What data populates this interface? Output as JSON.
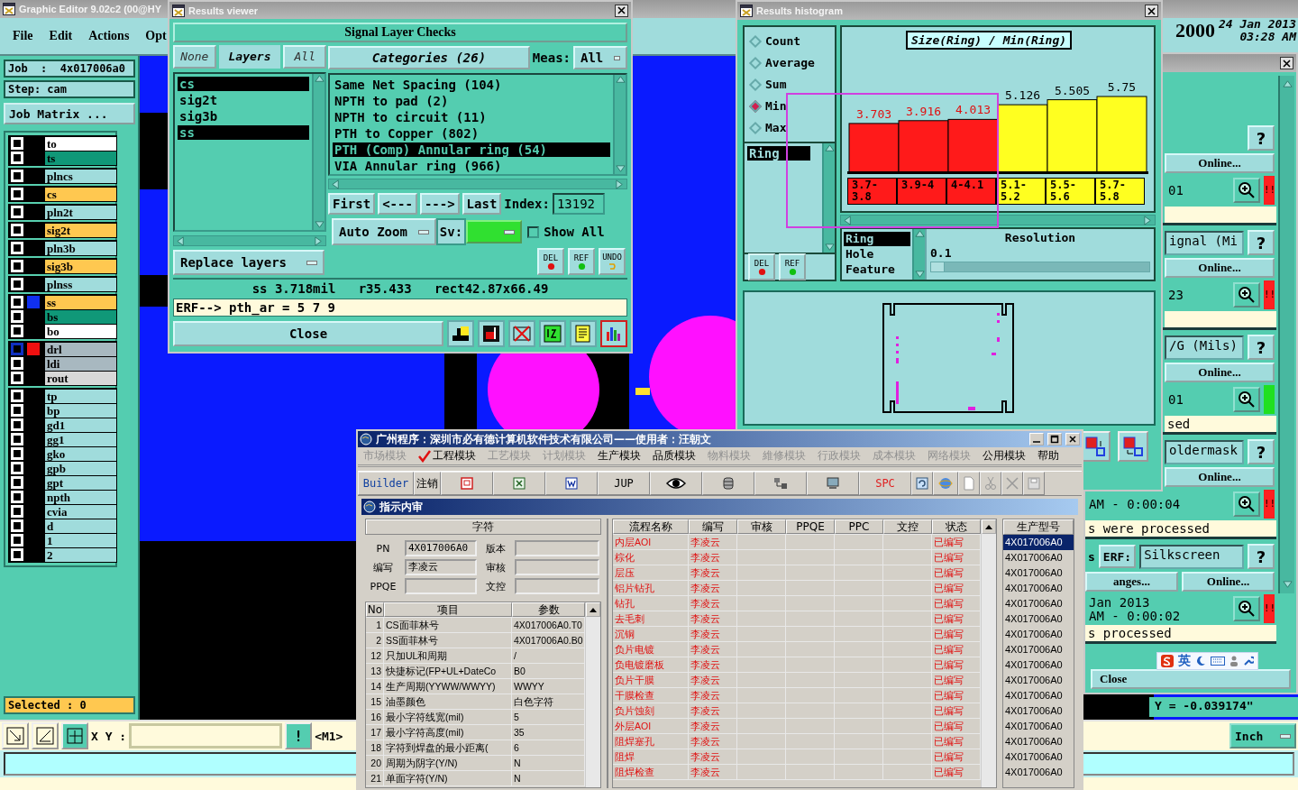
{
  "editor": {
    "title": "Graphic Editor 9.02c2 (00@HY",
    "menu": [
      "File",
      "Edit",
      "Actions",
      "Opt"
    ],
    "clock": {
      "year": "2000",
      "date": "24 Jan 2013",
      "time": "03:28 AM"
    },
    "job": "Job  :  4x017006a0",
    "step": "Step: cam",
    "job_matrix": "Job Matrix ...",
    "layer_groups": [
      [
        {
          "name": "to",
          "color": "#ffffff",
          "checked": false,
          "active": false
        },
        {
          "name": "ts",
          "color": "#109878",
          "checked": false,
          "active": false
        }
      ],
      [
        {
          "name": "plncs",
          "color": "#a0dcdc",
          "checked": false,
          "active": false
        }
      ],
      [
        {
          "name": "cs",
          "color": "#ffc850",
          "checked": false,
          "active": false
        }
      ],
      [
        {
          "name": "pln2t",
          "color": "#a0dcdc",
          "checked": false,
          "active": false
        }
      ],
      [
        {
          "name": "sig2t",
          "color": "#ffc850",
          "checked": false,
          "active": false
        }
      ],
      [
        {
          "name": "pln3b",
          "color": "#a0dcdc",
          "checked": false,
          "active": false
        }
      ],
      [
        {
          "name": "sig3b",
          "color": "#ffc850",
          "checked": false,
          "active": false
        }
      ],
      [
        {
          "name": "plnss",
          "color": "#a0dcdc",
          "checked": false,
          "active": false
        }
      ],
      [
        {
          "name": "ss",
          "color": "#ffc850",
          "swatch": {
            "color": "#1030f0"
          },
          "checked": false,
          "active": false
        },
        {
          "name": "bs",
          "color": "#109878",
          "checked": false,
          "active": false
        },
        {
          "name": "bo",
          "color": "#ffffff",
          "checked": false,
          "active": false
        }
      ],
      [
        {
          "name": "drl",
          "color": "#a8b8c0",
          "swatch": {
            "color": "#f01010"
          },
          "checked": false,
          "active": true
        },
        {
          "name": "ldi",
          "color": "#a8b8c0",
          "checked": false,
          "active": false
        },
        {
          "name": "rout",
          "color": "#d8d8d8",
          "checked": false,
          "active": false
        }
      ],
      [
        {
          "name": "tp",
          "color": "#a0dcdc",
          "checked": false,
          "active": false
        },
        {
          "name": "bp",
          "color": "#a0dcdc",
          "checked": false,
          "active": false
        },
        {
          "name": "gd1",
          "color": "#a0dcdc",
          "checked": false,
          "active": false
        },
        {
          "name": "gg1",
          "color": "#a0dcdc",
          "checked": false,
          "active": false
        },
        {
          "name": "gko",
          "color": "#a0dcdc",
          "checked": false,
          "active": false
        },
        {
          "name": "gpb",
          "color": "#a0dcdc",
          "checked": false,
          "active": false
        },
        {
          "name": "gpt",
          "color": "#a0dcdc",
          "checked": false,
          "active": false
        },
        {
          "name": "npth",
          "color": "#a0dcdc",
          "checked": false,
          "active": false
        },
        {
          "name": "cvia",
          "color": "#a0dcdc",
          "checked": false,
          "active": false
        },
        {
          "name": "d",
          "color": "#a0dcdc",
          "checked": false,
          "active": false
        },
        {
          "name": "1",
          "color": "#a0dcdc",
          "checked": false,
          "active": false
        },
        {
          "name": "2",
          "color": "#a0dcdc",
          "checked": false,
          "active": false
        }
      ]
    ],
    "selected": "Selected : 0",
    "xy_label": "X Y :",
    "alert": "!",
    "mode": "<M1>",
    "y_reading": "Y = -0.039174\"",
    "units": "Inch"
  },
  "results_viewer": {
    "title": "Results viewer",
    "heading": "Signal Layer Checks",
    "layer_tabs": [
      {
        "label": "None",
        "selected": false
      },
      {
        "label": "Layers",
        "selected": true
      },
      {
        "label": "All",
        "selected": false
      }
    ],
    "layers": [
      {
        "name": "cs",
        "selected": true
      },
      {
        "name": "sig2t",
        "selected": false
      },
      {
        "name": "sig3b",
        "selected": false
      },
      {
        "name": "ss",
        "selected": true
      }
    ],
    "categories_label": "Categories (26)",
    "meas_label": "Meas:",
    "meas_value": "All",
    "categories": [
      {
        "label": "Same Net Spacing (104)",
        "selected": false
      },
      {
        "label": "NPTH to pad (2)",
        "selected": false
      },
      {
        "label": "NPTH to circuit (11)",
        "selected": false
      },
      {
        "label": "PTH to Copper (802)",
        "selected": false
      },
      {
        "label": "PTH (Comp) Annular ring (54)",
        "selected": true
      },
      {
        "label": "VIA Annular ring (966)",
        "selected": false
      }
    ],
    "nav": [
      "First",
      "<---",
      "--->",
      "Last"
    ],
    "index_label": "Index:",
    "index_value": "13192",
    "zoom_mode": "Auto Zoom",
    "sv_label": "Sv:",
    "show_all": {
      "label": "Show All",
      "checked": false
    },
    "replace": "Replace layers",
    "edit_buttons": [
      "DEL",
      "REF",
      "UNDO"
    ],
    "measure": "ss 3.718mil   r35.433   rect42.87x66.49",
    "erf": "ERF--> pth_ar = 5 7 9",
    "close": "Close",
    "tools": [
      {
        "kind": "person",
        "selected": false
      },
      {
        "kind": "record",
        "selected": false
      },
      {
        "kind": "erase",
        "selected": false
      },
      {
        "kind": "number",
        "selected": false
      },
      {
        "kind": "report",
        "selected": false
      },
      {
        "kind": "histogram",
        "selected": true
      }
    ]
  },
  "histogram": {
    "title": "Results histogram",
    "modes": [
      {
        "label": "Count",
        "selected": false
      },
      {
        "label": "Average",
        "selected": false
      },
      {
        "label": "Sum",
        "selected": false
      },
      {
        "label": "Min",
        "selected": true
      },
      {
        "label": "Max",
        "selected": false
      }
    ],
    "items": [
      {
        "label": "Ring",
        "selected": true
      }
    ],
    "edit_buttons": [
      "DEL",
      "REF"
    ],
    "chart_data": {
      "type": "bar",
      "title": "Size(Ring) / Min(Ring)",
      "categories": [
        "3.7-3.8",
        "3.9-4",
        "4-4.1",
        "5.1-5.2",
        "5.5-5.6",
        "5.7-5.8"
      ],
      "stacked": true,
      "data_labels": true,
      "series": [
        {
          "color": "#ff1a1a",
          "values": [
            3.703,
            3.916,
            4.013,
            null,
            null,
            null
          ]
        },
        {
          "color": "#ffff20",
          "values": [
            null,
            null,
            null,
            5.126,
            5.505,
            5.75
          ]
        }
      ]
    },
    "fields": [
      {
        "label": "Ring",
        "selected": true
      },
      {
        "label": "Hole",
        "selected": false
      },
      {
        "label": "Feature",
        "selected": false
      }
    ],
    "resolution_label": "Resolution",
    "resolution_value": "0.1",
    "resolution_slider": {
      "level": 0.06
    }
  },
  "checklist": {
    "blocks": [
      {
        "help": "?",
        "online": "Online...",
        "time": "01",
        "color": "#ff2020",
        "alert": "!!"
      },
      {
        "name": "ignal (Mi",
        "help": "?",
        "online": "Online...",
        "time": "23",
        "color": "#ff2020",
        "alert": "!!"
      },
      {
        "name": "/G (Mils)",
        "help": "?",
        "online": "Online...",
        "time": "01",
        "color": "#20e020",
        "message": "sed"
      },
      {
        "name": "oldermask",
        "help": "?",
        "online": "Online...",
        "time": "AM - 0:00:04",
        "color": "#ff2020",
        "alert": "!!",
        "message": "s were processed"
      },
      {
        "prefix": "s",
        "erf": "ERF:",
        "name": "Silkscreen",
        "help": "?",
        "changes": "anges...",
        "online": "Online...",
        "date": "Jan 2013",
        "time": "AM - 0:00:02",
        "color": "#ff2020",
        "alert": "!!",
        "message": "s processed"
      }
    ],
    "close": "Close",
    "ime": "英"
  },
  "erp": {
    "title": "广州程序：深圳市必有德计算机软件技术有限公司——使用者：汪朝文",
    "menu": [
      {
        "label": "市场模块",
        "disabled": true,
        "checked": false
      },
      {
        "label": "工程模块",
        "disabled": false,
        "checked": true
      },
      {
        "label": "工艺模块",
        "disabled": true,
        "checked": false
      },
      {
        "label": "计划模块",
        "disabled": true,
        "checked": false
      },
      {
        "label": "生产模块",
        "disabled": false,
        "checked": false
      },
      {
        "label": "品质模块",
        "disabled": false,
        "checked": false
      },
      {
        "label": "物料模块",
        "disabled": true,
        "checked": false
      },
      {
        "label": "維修模块",
        "disabled": true,
        "checked": false
      },
      {
        "label": "行政模块",
        "disabled": true,
        "checked": false
      },
      {
        "label": "成本模块",
        "disabled": true,
        "checked": false
      },
      {
        "label": "网络模块",
        "disabled": true,
        "checked": false
      },
      {
        "label": "公用模块",
        "disabled": false,
        "checked": false
      },
      {
        "label": "帮助",
        "disabled": false,
        "checked": false
      }
    ],
    "toolbar": [
      {
        "kind": "text",
        "label": "Builder",
        "color": "#1040a0"
      },
      {
        "kind": "text",
        "label": "注销",
        "color": "#000000"
      },
      {
        "kind": "pdf"
      },
      {
        "kind": "excel"
      },
      {
        "kind": "word"
      },
      {
        "kind": "text",
        "label": "JUP",
        "color": "#000000"
      },
      {
        "kind": "eye"
      },
      {
        "kind": "database"
      },
      {
        "kind": "network"
      },
      {
        "kind": "monitor"
      },
      {
        "kind": "text",
        "label": "SPC",
        "color": "#e02020"
      },
      {
        "kind": "refresh"
      },
      {
        "kind": "globe"
      },
      {
        "kind": "page"
      },
      {
        "kind": "cut"
      },
      {
        "kind": "delete"
      },
      {
        "kind": "save"
      }
    ],
    "subtitle": "指示内审",
    "char_header": "字符",
    "form": [
      {
        "label": "PN",
        "value": "4X017006A0"
      },
      {
        "label": "版本"
      },
      {
        "label": "编写",
        "value": "李凌云"
      },
      {
        "label": "审核"
      },
      {
        "label": "PPQE"
      },
      {
        "label": "文控"
      }
    ],
    "params": {
      "columns": [
        "No",
        "项目",
        "参数"
      ],
      "rows": [
        [
          "1",
          "CS面菲林号",
          "4X017006A0.T0"
        ],
        [
          "2",
          "SS面菲林号",
          "4X017006A0.B0"
        ],
        [
          "12",
          "只加UL和周期",
          "/"
        ],
        [
          "13",
          "快捷标记(FP+UL+DateCo",
          "B0"
        ],
        [
          "14",
          "生产周期(YYWW/WWYY)",
          "WWYY"
        ],
        [
          "15",
          "油墨颜色",
          "白色字符"
        ],
        [
          "16",
          "最小字符线宽(mil)",
          "5"
        ],
        [
          "17",
          "最小字符高度(mil)",
          "35"
        ],
        [
          "18",
          "字符到焊盘的最小距离(",
          "6"
        ],
        [
          "20",
          "周期为阴字(Y/N)",
          "N"
        ],
        [
          "21",
          "单面字符(Y/N)",
          "N"
        ]
      ]
    },
    "flow": {
      "columns": [
        "流程名称",
        "编写",
        "审核",
        "PPQE",
        "PPC",
        "文控",
        "状态"
      ],
      "rows": [
        {
          "name": "内层AOI",
          "writer": "李凌云",
          "status": "已编写"
        },
        {
          "name": "棕化",
          "writer": "李凌云",
          "status": "已编写"
        },
        {
          "name": "层压",
          "writer": "李凌云",
          "status": "已编写"
        },
        {
          "name": "铝片钻孔",
          "writer": "李凌云",
          "status": "已编写"
        },
        {
          "name": "钻孔",
          "writer": "李凌云",
          "status": "已编写"
        },
        {
          "name": "去毛刺",
          "writer": "李凌云",
          "status": "已编写"
        },
        {
          "name": "沉铜",
          "writer": "李凌云",
          "status": "已编写"
        },
        {
          "name": "负片电镀",
          "writer": "李凌云",
          "status": "已编写"
        },
        {
          "name": "负电镀磨板",
          "writer": "李凌云",
          "status": "已编写"
        },
        {
          "name": "负片干膜",
          "writer": "李凌云",
          "status": "已编写"
        },
        {
          "name": "干膜检查",
          "writer": "李凌云",
          "status": "已编写"
        },
        {
          "name": "负片蚀刻",
          "writer": "李凌云",
          "status": "已编写"
        },
        {
          "name": "外层AOI",
          "writer": "李凌云",
          "status": "已编写"
        },
        {
          "name": "阻焊塞孔",
          "writer": "李凌云",
          "status": "已编写"
        },
        {
          "name": "阻焊",
          "writer": "李凌云",
          "status": "已编写"
        },
        {
          "name": "阻焊检查",
          "writer": "李凌云",
          "status": "已编写"
        }
      ]
    },
    "models": {
      "header": "生产型号",
      "rows": [
        {
          "label": "4X017006A0",
          "selected": true
        },
        {
          "label": "4X017006A0",
          "selected": false
        },
        {
          "label": "4X017006A0",
          "selected": false
        },
        {
          "label": "4X017006A0",
          "selected": false
        },
        {
          "label": "4X017006A0",
          "selected": false
        },
        {
          "label": "4X017006A0",
          "selected": false
        },
        {
          "label": "4X017006A0",
          "selected": false
        },
        {
          "label": "4X017006A0",
          "selected": false
        },
        {
          "label": "4X017006A0",
          "selected": false
        },
        {
          "label": "4X017006A0",
          "selected": false
        },
        {
          "label": "4X017006A0",
          "selected": false
        },
        {
          "label": "4X017006A0",
          "selected": false
        },
        {
          "label": "4X017006A0",
          "selected": false
        },
        {
          "label": "4X017006A0",
          "selected": false
        },
        {
          "label": "4X017006A0",
          "selected": false
        },
        {
          "label": "4X017006A0",
          "selected": false
        }
      ]
    }
  }
}
